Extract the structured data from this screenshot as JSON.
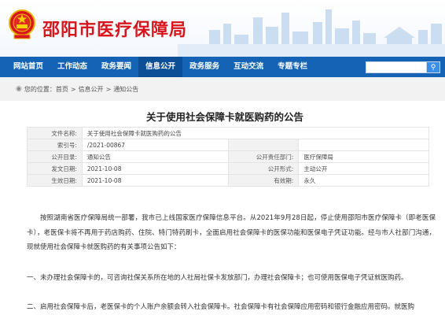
{
  "site": {
    "title": "邵阳市医疗保障局"
  },
  "nav": {
    "items": [
      "网站首页",
      "工作动态",
      "政务要闻",
      "信息公开",
      "政务服务",
      "互动交流",
      "专题专栏"
    ],
    "active_index": 3,
    "search_placeholder": ""
  },
  "breadcrumb": {
    "prefix": "您的位置：",
    "items": [
      "首页",
      "信息公开",
      "通知公告"
    ]
  },
  "article": {
    "title": "关于使用社会保障卡就医购药的公告"
  },
  "meta": {
    "row1": {
      "label": "文件名称:",
      "value": "关于使用社会保障卡就医购药的公告"
    },
    "row2": {
      "label": "索引号:",
      "value": "/2021-00867"
    },
    "row3": {
      "label1": "公开目录:",
      "value1": "通知公告",
      "label2": "公开责任部门:",
      "value2": "医疗保障局"
    },
    "row4": {
      "label1": "发文日期:",
      "value1": "2021-10-08",
      "label2": "公开形式:",
      "value2": "主动公开"
    },
    "row5": {
      "label1": "生效日期:",
      "value1": "2021-10-08",
      "label2": "有效期:",
      "value2": "永久"
    }
  },
  "body": {
    "p1": "按照湖南省医疗保障局统一部署，我市已上线国家医疗保障信息平台。从2021年9月28日起，停止使用邵阳市医疗保障卡（即老医保卡），老医保卡将不再用于药店购药、住院、特门特药刷卡，全面启用社会保障卡的医保功能和医保电子凭证功能。经与市人社部门沟通，现就使用社会保障卡就医购药的有关事项公告如下：",
    "p2": "一、未办理社会保障卡的，可咨询社保关系所在地的人社局社保卡发放部门，办理社会保障卡；也可使用医保电子凭证就医购药。",
    "p3": "二、启用社会保障卡后，老医保卡的个人账户余额会转入社会保障卡。社会保障卡有社会保障应用密码和银行金融应用密码。就医购"
  },
  "colors": {
    "brand_red": "#d7151c",
    "nav_blue": "#1463b4"
  }
}
